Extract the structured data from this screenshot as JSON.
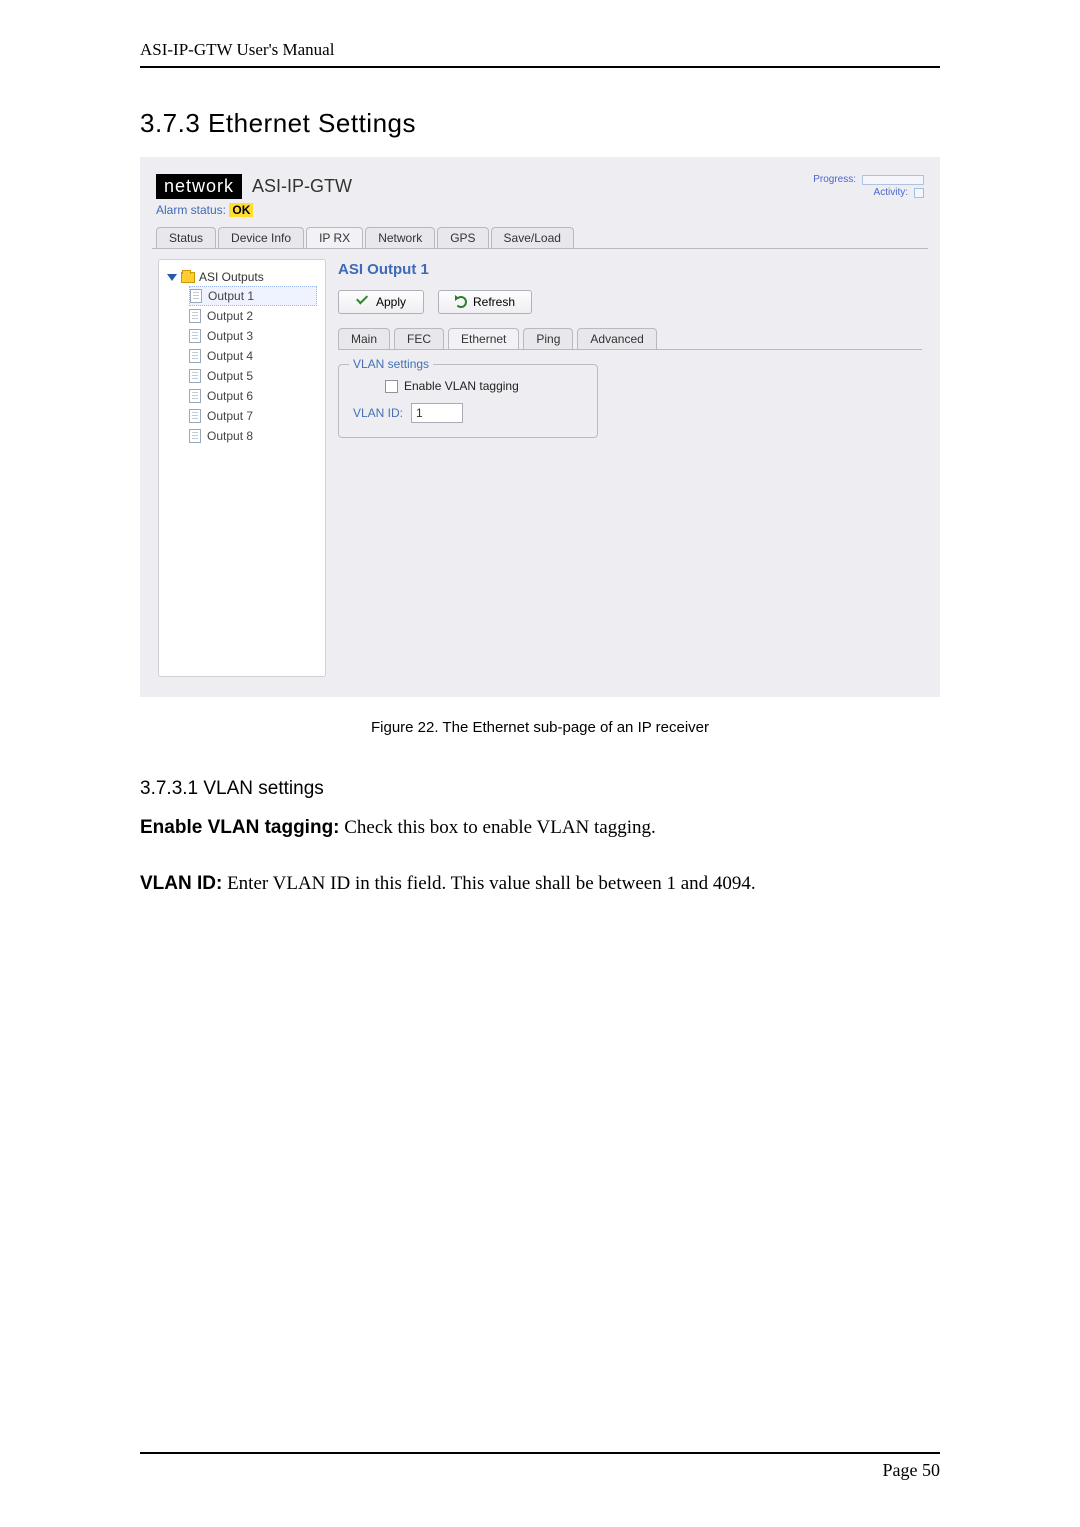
{
  "header": "ASI-IP-GTW User's Manual",
  "section_heading": "3.7.3 Ethernet Settings",
  "ui": {
    "brand_box": "network",
    "brand_name": "ASI-IP-GTW",
    "progress_label": "Progress:",
    "activity_label": "Activity:",
    "alarm_prefix": "Alarm status: ",
    "alarm_value": "OK",
    "main_tabs": [
      "Status",
      "Device Info",
      "IP RX",
      "Network",
      "GPS",
      "Save/Load"
    ],
    "main_tabs_active_index": 2,
    "tree": {
      "root": "ASI Outputs",
      "items": [
        "Output 1",
        "Output 2",
        "Output 3",
        "Output 4",
        "Output 5",
        "Output 6",
        "Output 7",
        "Output 8"
      ],
      "selected_index": 0
    },
    "content": {
      "title": "ASI Output 1",
      "apply_label": "Apply",
      "refresh_label": "Refresh",
      "inner_tabs": [
        "Main",
        "FEC",
        "Ethernet",
        "Ping",
        "Advanced"
      ],
      "inner_tabs_active_index": 2,
      "fieldset_legend": "VLAN settings",
      "checkbox_label": "Enable VLAN tagging",
      "vlan_id_label": "VLAN ID:",
      "vlan_id_value": "1"
    }
  },
  "figure_caption": "Figure 22. The Ethernet sub-page of an IP receiver",
  "subsection_heading": "3.7.3.1   VLAN settings",
  "para1_label": "Enable VLAN tagging:",
  "para1_rest": " Check this box to enable VLAN tagging.",
  "para2_label": "VLAN ID:",
  "para2_rest": " Enter VLAN ID in this field. This value shall be between 1 and 4094.",
  "footer": "Page 50"
}
